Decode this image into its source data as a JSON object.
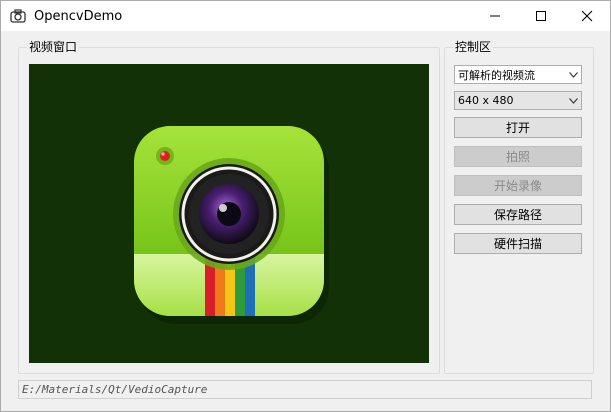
{
  "window": {
    "title": "OpencvDemo"
  },
  "video_group": {
    "title": "视频窗口"
  },
  "control_group": {
    "title": "控制区",
    "source_combo": {
      "value": "可解析的视频流"
    },
    "resolution_combo": {
      "value": "640 x 480"
    },
    "buttons": [
      {
        "label": "打开",
        "enabled": true
      },
      {
        "label": "拍照",
        "enabled": false
      },
      {
        "label": "开始录像",
        "enabled": false
      },
      {
        "label": "保存路径",
        "enabled": true
      },
      {
        "label": "硬件扫描",
        "enabled": true
      }
    ]
  },
  "statusbar": {
    "path": "E:/Materials/Qt/VedioCapture"
  },
  "colors": {
    "video_bg": "#133107",
    "camera_body": "#8ed62b"
  },
  "icons": {
    "app": "camera-icon",
    "minimize": "minimize-icon",
    "maximize": "maximize-icon",
    "close": "close-icon"
  }
}
